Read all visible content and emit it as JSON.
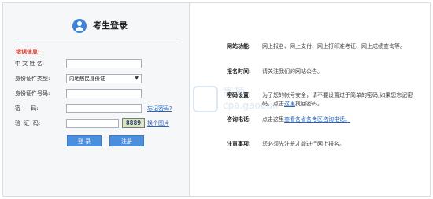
{
  "login": {
    "title": "考生登录",
    "error_label": "错误信息:",
    "fields": {
      "name_label": "中 文 姓 名:",
      "id_type_label": "身份证件类型:",
      "id_type_value": "内地居民身份证",
      "id_number_label": "身份证件号码:",
      "password_label": "密      码:",
      "captcha_label": "验  证  码:",
      "captcha_text": "8889"
    },
    "links": {
      "forgot_password": "忘记密码?",
      "change_image": "换个图片"
    },
    "buttons": {
      "login": "登 录",
      "register": "注册"
    }
  },
  "info": {
    "items": [
      {
        "key": "网站功能:",
        "value": "网上报名、网上支付、网上打印准考证、网上成绩查询等。"
      },
      {
        "key": "报名时间:",
        "value": "请关注我们的网站公告。"
      },
      {
        "key": "密码设置:",
        "value_pre": "为了您的帐号安全，请不要设置过于简单的密码,如果您忘记密码，点击",
        "link": "这里",
        "value_post": "找回密码。"
      },
      {
        "key": "咨询电话:",
        "value_pre": "点击这里",
        "link": "查看各省各考区咨询电话。",
        "value_post": ""
      },
      {
        "key": "注意事项:",
        "value": "您必须先注册才能进行网上报名。"
      }
    ]
  },
  "watermark": {
    "text1": "高顿",
    "text2": "cpa.gaodun"
  },
  "colors": {
    "accent": "#4a8fde",
    "error": "#d23b2c",
    "link": "#2a62b6"
  }
}
